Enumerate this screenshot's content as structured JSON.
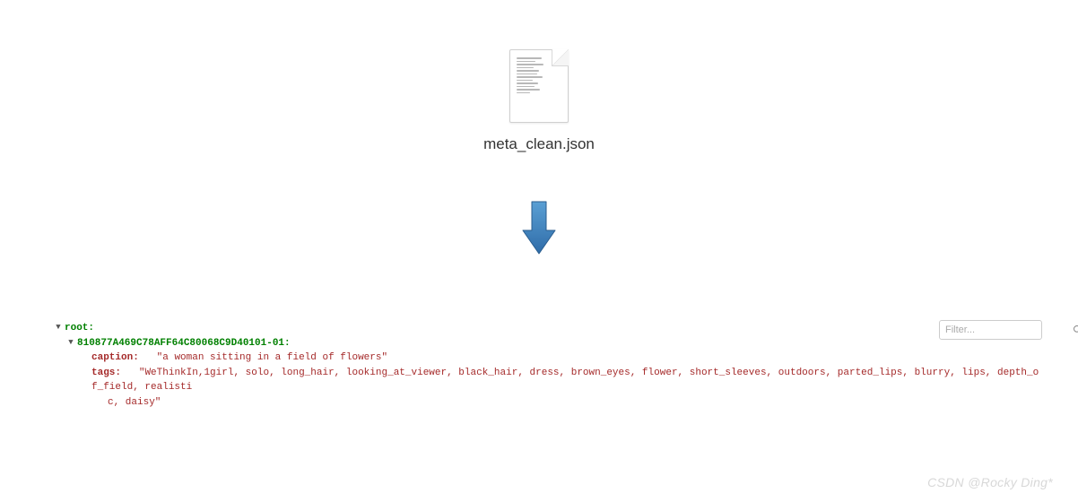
{
  "file": {
    "name": "meta_clean.json"
  },
  "filter": {
    "placeholder": "Filter..."
  },
  "json": {
    "root_label": "root:",
    "id_label": "810877A469C78AFF64C80068C9D40101-01:",
    "caption_key": "caption:",
    "caption_value": "\"a woman sitting in a field of flowers\"",
    "tags_key": "tags:",
    "tags_value_line1": "\"WeThinkIn,1girl, solo, long_hair, looking_at_viewer, black_hair, dress, brown_eyes, flower, short_sleeves, outdoors, parted_lips, blurry, lips, depth_of_field, realisti",
    "tags_value_line2": "c, daisy\""
  },
  "watermark": "CSDN @Rocky Ding*"
}
